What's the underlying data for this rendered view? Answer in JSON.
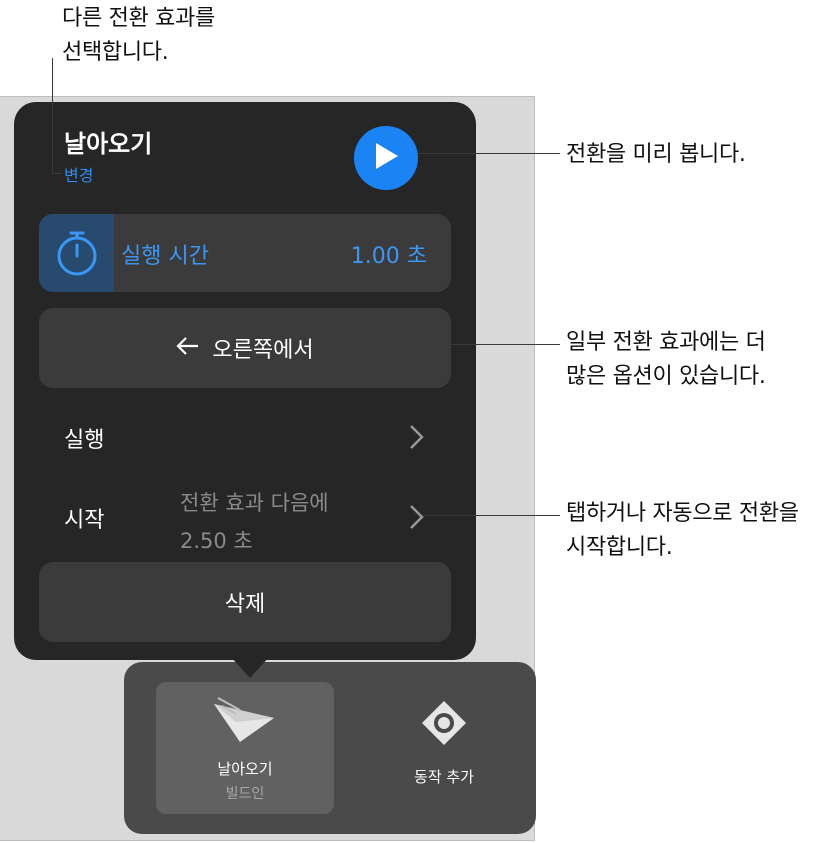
{
  "callouts": {
    "top_left": "다른 전환 효과를\n선택합니다.",
    "preview": "전환을 미리 봅니다.",
    "options": "일부 전환 효과에는 더\n많은 옵션이 있습니다.",
    "start": "탭하거나 자동으로 전환을\n시작합니다."
  },
  "panel": {
    "title": "날아오기",
    "change_link": "변경",
    "duration_label": "실행 시간",
    "duration_value": "1.00 초",
    "direction_label": "오른쪽에서",
    "run_label": "실행",
    "start_label": "시작",
    "start_description": "전환 효과 다음에\n2.50 초",
    "delete_label": "삭제"
  },
  "toolbar": {
    "item1_label": "날아오기",
    "item1_sub": "빌드인",
    "item2_label": "동작 추가"
  },
  "colors": {
    "accent": "#1a84f5",
    "panel_bg": "#262626",
    "row_bg": "#3b3b3b"
  }
}
